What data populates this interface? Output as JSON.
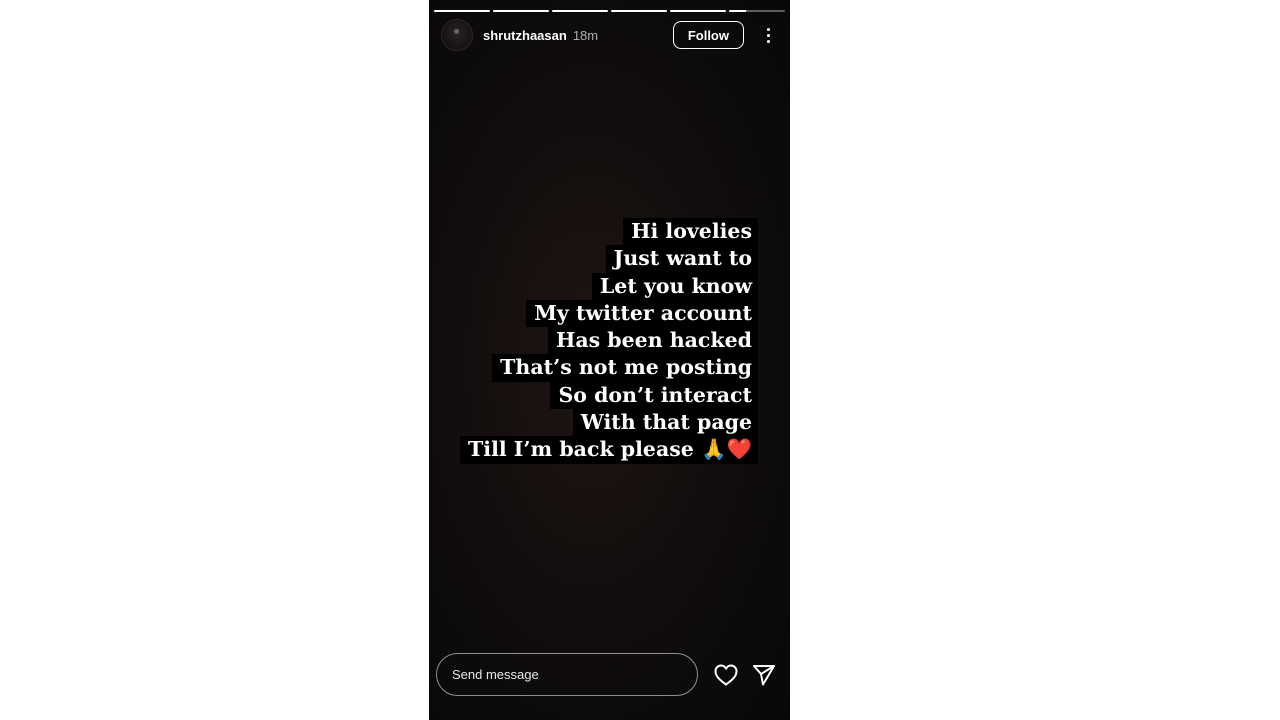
{
  "story": {
    "progress": [
      1,
      1,
      1,
      1,
      1,
      0.3
    ],
    "header": {
      "username": "shrutzhaasan",
      "time_ago": "18m",
      "follow_label": "Follow"
    },
    "caption_lines": [
      "Hi lovelies",
      "Just want to",
      "Let you know",
      "My twitter account",
      "Has been hacked",
      "That’s not me posting",
      "So don’t interact",
      "With that page",
      "Till I’m back please 🙏❤️"
    ],
    "reply": {
      "placeholder": "Send message"
    },
    "icons": {
      "avatar": "profile-avatar",
      "more": "more-options-icon",
      "like": "heart-icon",
      "share": "send-icon"
    }
  }
}
